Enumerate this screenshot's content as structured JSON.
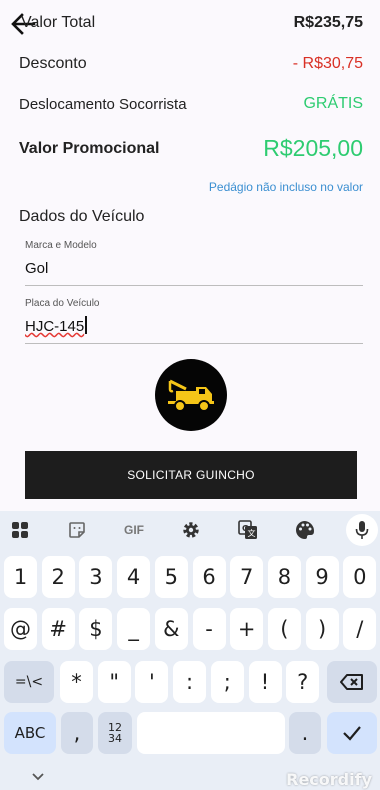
{
  "summary": {
    "total_label": "Valor Total",
    "total_value": "R$235,75",
    "discount_label": "Desconto",
    "discount_value": "- R$30,75",
    "travel_label": "Deslocamento Socorrista",
    "travel_value": "GRÁTIS",
    "promo_label": "Valor Promocional",
    "promo_value": "R$205,00",
    "toll_note": "Pedágio não incluso no valor"
  },
  "vehicle": {
    "section_title": "Dados do Veículo",
    "model_label": "Marca e Modelo",
    "model_value": "Gol",
    "plate_label": "Placa do Veículo",
    "plate_value": "HJC-145"
  },
  "action": {
    "request_label": "SOLICITAR GUINCHO"
  },
  "keyboard": {
    "toolbar": {
      "gif_label": "GIF"
    },
    "row1": [
      "1",
      "2",
      "3",
      "4",
      "5",
      "6",
      "7",
      "8",
      "9",
      "0"
    ],
    "row2": [
      "@",
      "#",
      "$",
      "_",
      "&",
      "-",
      "+",
      "(",
      ")",
      "/"
    ],
    "row3_symbols_label": "=\\<",
    "row3": [
      "*",
      "\"",
      "'",
      ":",
      ";",
      "!",
      "?"
    ],
    "abc_label": "ABC",
    "comma": ",",
    "numpad_label": "12\n34",
    "period": "."
  },
  "watermark": "Recordify",
  "colors": {
    "accent_green": "#2ecc71",
    "discount_red": "#d93025",
    "link_blue": "#3b8fd1",
    "truck_yellow": "#f5c518"
  }
}
